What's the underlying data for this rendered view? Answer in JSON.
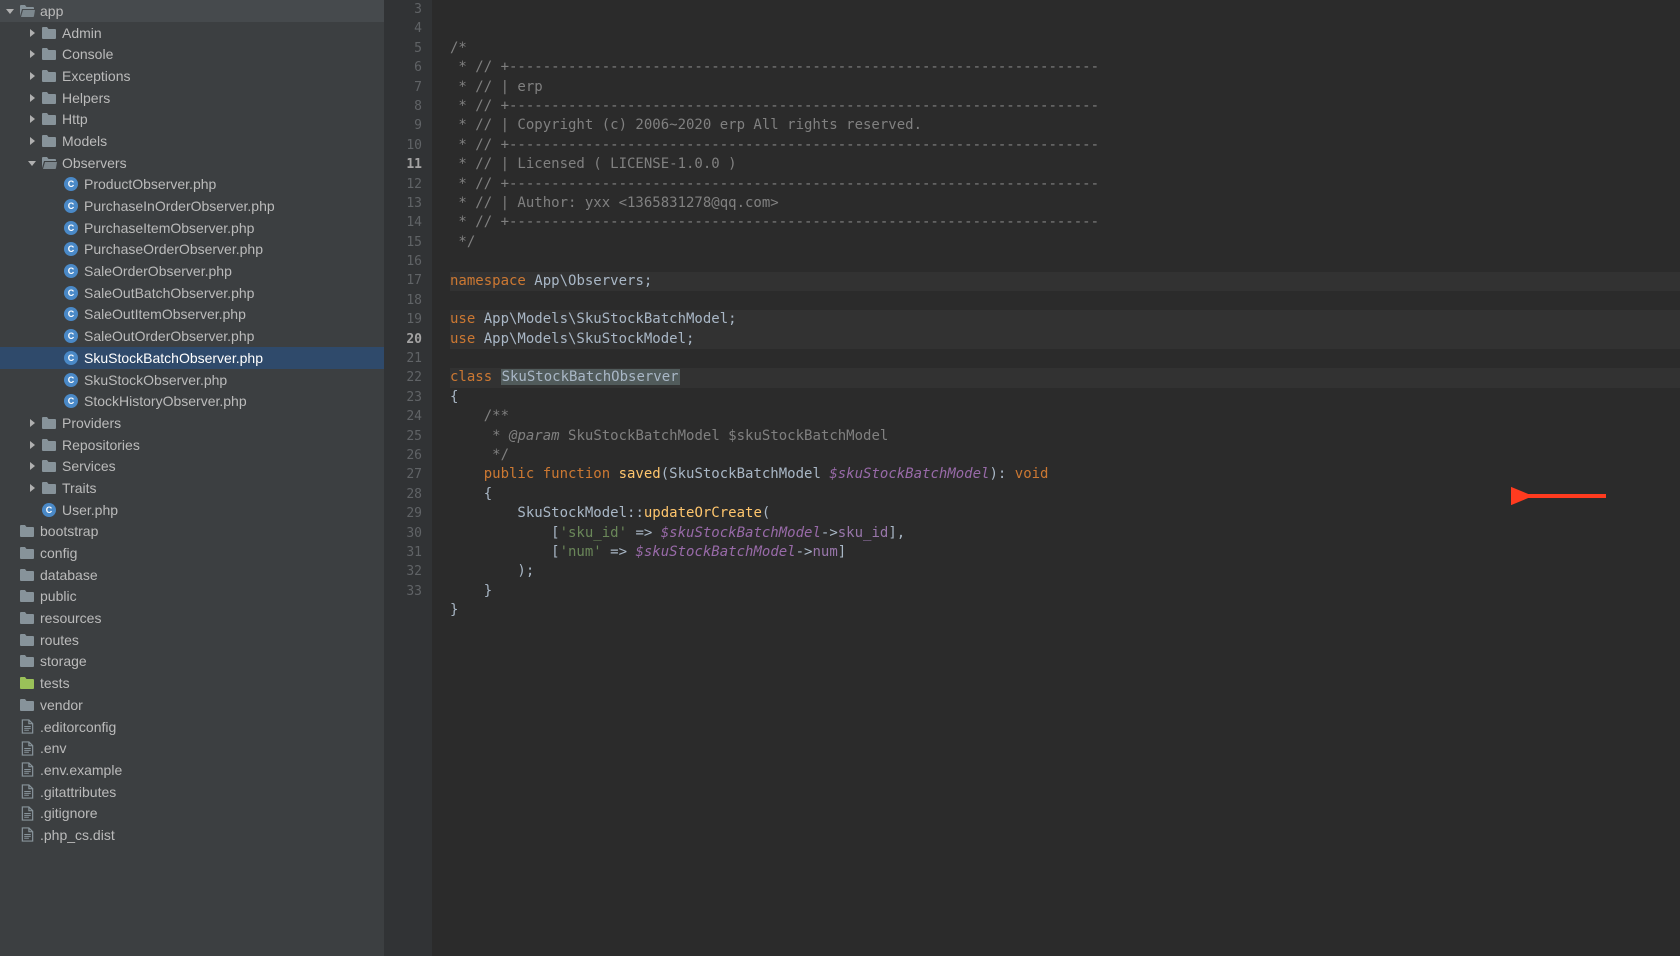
{
  "sidebar": {
    "items": [
      {
        "label": "app",
        "depth": 0,
        "arrow": "down",
        "icon": "folder-open"
      },
      {
        "label": "Admin",
        "depth": 1,
        "arrow": "right",
        "icon": "folder"
      },
      {
        "label": "Console",
        "depth": 1,
        "arrow": "right",
        "icon": "folder"
      },
      {
        "label": "Exceptions",
        "depth": 1,
        "arrow": "right",
        "icon": "folder"
      },
      {
        "label": "Helpers",
        "depth": 1,
        "arrow": "right",
        "icon": "folder"
      },
      {
        "label": "Http",
        "depth": 1,
        "arrow": "right",
        "icon": "folder"
      },
      {
        "label": "Models",
        "depth": 1,
        "arrow": "right",
        "icon": "folder"
      },
      {
        "label": "Observers",
        "depth": 1,
        "arrow": "down",
        "icon": "folder-open"
      },
      {
        "label": "ProductObserver.php",
        "depth": 2,
        "arrow": "none",
        "icon": "class"
      },
      {
        "label": "PurchaseInOrderObserver.php",
        "depth": 2,
        "arrow": "none",
        "icon": "class"
      },
      {
        "label": "PurchaseItemObserver.php",
        "depth": 2,
        "arrow": "none",
        "icon": "class"
      },
      {
        "label": "PurchaseOrderObserver.php",
        "depth": 2,
        "arrow": "none",
        "icon": "class"
      },
      {
        "label": "SaleOrderObserver.php",
        "depth": 2,
        "arrow": "none",
        "icon": "class"
      },
      {
        "label": "SaleOutBatchObserver.php",
        "depth": 2,
        "arrow": "none",
        "icon": "class"
      },
      {
        "label": "SaleOutItemObserver.php",
        "depth": 2,
        "arrow": "none",
        "icon": "class"
      },
      {
        "label": "SaleOutOrderObserver.php",
        "depth": 2,
        "arrow": "none",
        "icon": "class"
      },
      {
        "label": "SkuStockBatchObserver.php",
        "depth": 2,
        "arrow": "none",
        "icon": "class",
        "selected": true
      },
      {
        "label": "SkuStockObserver.php",
        "depth": 2,
        "arrow": "none",
        "icon": "class"
      },
      {
        "label": "StockHistoryObserver.php",
        "depth": 2,
        "arrow": "none",
        "icon": "class"
      },
      {
        "label": "Providers",
        "depth": 1,
        "arrow": "right",
        "icon": "folder"
      },
      {
        "label": "Repositories",
        "depth": 1,
        "arrow": "right",
        "icon": "folder"
      },
      {
        "label": "Services",
        "depth": 1,
        "arrow": "right",
        "icon": "folder"
      },
      {
        "label": "Traits",
        "depth": 1,
        "arrow": "right",
        "icon": "folder"
      },
      {
        "label": "User.php",
        "depth": 1,
        "arrow": "none",
        "icon": "class"
      },
      {
        "label": "bootstrap",
        "depth": 0,
        "arrow": "none",
        "icon": "folder"
      },
      {
        "label": "config",
        "depth": 0,
        "arrow": "none",
        "icon": "folder"
      },
      {
        "label": "database",
        "depth": 0,
        "arrow": "none",
        "icon": "folder"
      },
      {
        "label": "public",
        "depth": 0,
        "arrow": "none",
        "icon": "folder"
      },
      {
        "label": "resources",
        "depth": 0,
        "arrow": "none",
        "icon": "folder"
      },
      {
        "label": "routes",
        "depth": 0,
        "arrow": "none",
        "icon": "folder"
      },
      {
        "label": "storage",
        "depth": 0,
        "arrow": "none",
        "icon": "folder"
      },
      {
        "label": "tests",
        "depth": 0,
        "arrow": "none",
        "icon": "folder-tests"
      },
      {
        "label": "vendor",
        "depth": 0,
        "arrow": "none",
        "icon": "folder"
      },
      {
        "label": ".editorconfig",
        "depth": 0,
        "arrow": "none",
        "icon": "file"
      },
      {
        "label": ".env",
        "depth": 0,
        "arrow": "none",
        "icon": "file"
      },
      {
        "label": ".env.example",
        "depth": 0,
        "arrow": "none",
        "icon": "file"
      },
      {
        "label": ".gitattributes",
        "depth": 0,
        "arrow": "none",
        "icon": "file"
      },
      {
        "label": ".gitignore",
        "depth": 0,
        "arrow": "none",
        "icon": "file"
      },
      {
        "label": ".php_cs.dist",
        "depth": 0,
        "arrow": "none",
        "icon": "file"
      }
    ]
  },
  "editor": {
    "gutter_start": 3,
    "gutter_end": 33,
    "bold_lines": [
      11,
      20
    ],
    "highlighted_lines": [
      15,
      17,
      18,
      20
    ],
    "lines": [
      {
        "n": 3,
        "segs": [
          {
            "t": "/*",
            "c": "cmt"
          }
        ]
      },
      {
        "n": 4,
        "segs": [
          {
            "t": " * // +----------------------------------------------------------------------",
            "c": "cmt"
          }
        ]
      },
      {
        "n": 5,
        "segs": [
          {
            "t": " * // | erp",
            "c": "cmt"
          }
        ]
      },
      {
        "n": 6,
        "segs": [
          {
            "t": " * // +----------------------------------------------------------------------",
            "c": "cmt"
          }
        ]
      },
      {
        "n": 7,
        "segs": [
          {
            "t": " * // | Copyright (c) 2006~2020 erp All rights reserved.",
            "c": "cmt"
          }
        ]
      },
      {
        "n": 8,
        "segs": [
          {
            "t": " * // +----------------------------------------------------------------------",
            "c": "cmt"
          }
        ]
      },
      {
        "n": 9,
        "segs": [
          {
            "t": " * // | Licensed ( LICENSE-1.0.0 )",
            "c": "cmt"
          }
        ]
      },
      {
        "n": 10,
        "segs": [
          {
            "t": " * // +----------------------------------------------------------------------",
            "c": "cmt"
          }
        ]
      },
      {
        "n": 11,
        "segs": [
          {
            "t": " * // | Author: yxx <1365831278@qq.com>",
            "c": "cmt"
          }
        ]
      },
      {
        "n": 12,
        "segs": [
          {
            "t": " * // +----------------------------------------------------------------------",
            "c": "cmt"
          }
        ]
      },
      {
        "n": 13,
        "segs": [
          {
            "t": " */",
            "c": "cmt"
          }
        ]
      },
      {
        "n": 14,
        "segs": []
      },
      {
        "n": 15,
        "segs": [
          {
            "t": "namespace ",
            "c": "kw"
          },
          {
            "t": "App\\Observers;",
            "c": "cls"
          }
        ]
      },
      {
        "n": 16,
        "segs": []
      },
      {
        "n": 17,
        "segs": [
          {
            "t": "use ",
            "c": "kw"
          },
          {
            "t": "App\\Models\\SkuStockBatchModel;",
            "c": "cls"
          }
        ]
      },
      {
        "n": 18,
        "segs": [
          {
            "t": "use ",
            "c": "kw"
          },
          {
            "t": "App\\Models\\SkuStockModel;",
            "c": "cls"
          }
        ]
      },
      {
        "n": 19,
        "segs": []
      },
      {
        "n": 20,
        "segs": [
          {
            "t": "class ",
            "c": "kw"
          },
          {
            "t": "SkuStockBatchObserver",
            "c": "highlight-box"
          }
        ]
      },
      {
        "n": 21,
        "segs": [
          {
            "t": "{",
            "c": "cls"
          }
        ]
      },
      {
        "n": 22,
        "segs": [
          {
            "t": "    /**",
            "c": "cmt"
          }
        ]
      },
      {
        "n": 23,
        "segs": [
          {
            "t": "     * ",
            "c": "cmt"
          },
          {
            "t": "@param ",
            "c": "tag"
          },
          {
            "t": "SkuStockBatchModel $skuStockBatchModel",
            "c": "cmt"
          }
        ]
      },
      {
        "n": 24,
        "segs": [
          {
            "t": "     */",
            "c": "cmt"
          }
        ]
      },
      {
        "n": 25,
        "segs": [
          {
            "t": "    ",
            "c": "cls"
          },
          {
            "t": "public function ",
            "c": "kw"
          },
          {
            "t": "saved",
            "c": "func"
          },
          {
            "t": "(SkuStockBatchModel ",
            "c": "cls"
          },
          {
            "t": "$skuStockBatchModel",
            "c": "param"
          },
          {
            "t": "): ",
            "c": "cls"
          },
          {
            "t": "void",
            "c": "kw"
          }
        ]
      },
      {
        "n": 26,
        "segs": [
          {
            "t": "    {",
            "c": "cls"
          }
        ]
      },
      {
        "n": 27,
        "segs": [
          {
            "t": "        SkuStockModel",
            "c": "cls"
          },
          {
            "t": "::",
            "c": "cls"
          },
          {
            "t": "updateOrCreate",
            "c": "func"
          },
          {
            "t": "(",
            "c": "cls"
          }
        ]
      },
      {
        "n": 28,
        "segs": [
          {
            "t": "            [",
            "c": "cls"
          },
          {
            "t": "'sku_id'",
            "c": "str"
          },
          {
            "t": " => ",
            "c": "cls"
          },
          {
            "t": "$skuStockBatchModel",
            "c": "param"
          },
          {
            "t": "->",
            "c": "cls"
          },
          {
            "t": "sku_id",
            "c": "const"
          },
          {
            "t": "],",
            "c": "cls"
          }
        ]
      },
      {
        "n": 29,
        "segs": [
          {
            "t": "            [",
            "c": "cls"
          },
          {
            "t": "'num'",
            "c": "str"
          },
          {
            "t": " => ",
            "c": "cls"
          },
          {
            "t": "$skuStockBatchModel",
            "c": "param"
          },
          {
            "t": "->",
            "c": "cls"
          },
          {
            "t": "num",
            "c": "const"
          },
          {
            "t": "]",
            "c": "cls"
          }
        ]
      },
      {
        "n": 30,
        "segs": [
          {
            "t": "        );",
            "c": "cls"
          }
        ]
      },
      {
        "n": 31,
        "segs": [
          {
            "t": "    }",
            "c": "cls"
          }
        ]
      },
      {
        "n": 32,
        "segs": [
          {
            "t": "}",
            "c": "cls"
          }
        ]
      },
      {
        "n": 33,
        "segs": []
      }
    ]
  }
}
